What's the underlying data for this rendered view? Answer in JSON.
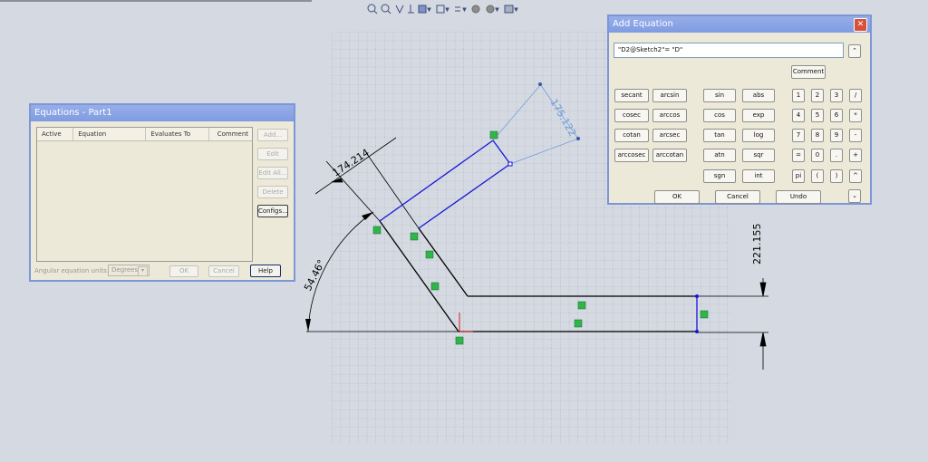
{
  "toolbar": {
    "icons": [
      "zoom-fit-icon",
      "zoom-area-icon",
      "prev-view-icon",
      "section-view-icon",
      "view-orient-icon",
      "display-style-icon",
      "hide-show-icon",
      "edit-appearance-icon",
      "scene-icon",
      "view-settings-icon"
    ]
  },
  "sketch": {
    "dim_length": "174.214",
    "dim_angle": "54.46°",
    "dim_height": "221.155",
    "dim_diag": "175.122"
  },
  "equations": {
    "title": "Equations - Part1",
    "columns": [
      "Active",
      "Equation",
      "Evaluates To",
      "Comment"
    ],
    "buttons": {
      "add": "Add...",
      "edit": "Edit",
      "edit_all": "Edit All...",
      "delete": "Delete",
      "configs": "Configs...",
      "ok": "OK",
      "cancel": "Cancel",
      "help": "Help"
    },
    "angular_units_label": "Angular equation units:",
    "angular_units_value": "Degrees"
  },
  "add_equation": {
    "title": "Add Equation",
    "input_value": "\"D2@Sketch2\"= \"D\"",
    "comment_label": "Comment",
    "funcs": [
      "secant",
      "arcsin",
      "cosec",
      "arccos",
      "cotan",
      "arcsec",
      "arccosec",
      "arccotan"
    ],
    "funcs2": [
      "sin",
      "abs",
      "cos",
      "exp",
      "tan",
      "log",
      "atn",
      "sqr",
      "sgn",
      "int"
    ],
    "keypad": [
      "1",
      "2",
      "3",
      "/",
      "4",
      "5",
      "6",
      "*",
      "7",
      "8",
      "9",
      "-",
      "=",
      "0",
      ".",
      "+",
      "pi",
      "(",
      ")",
      "^"
    ],
    "ok": "OK",
    "cancel": "Cancel",
    "undo": "Undo"
  }
}
